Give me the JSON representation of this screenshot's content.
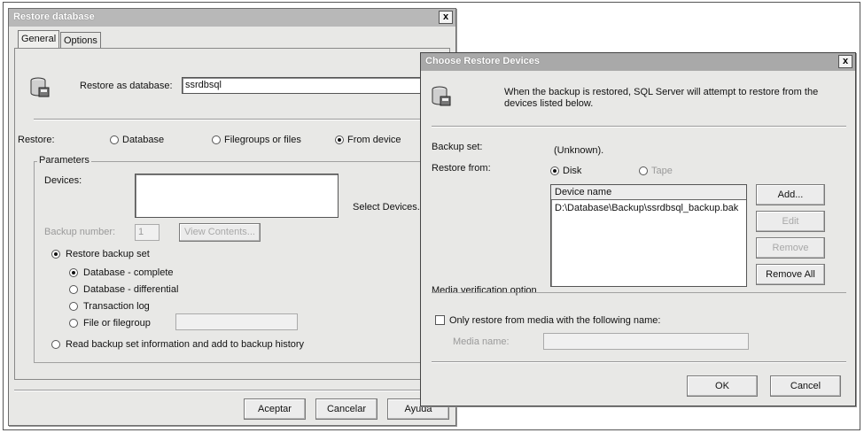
{
  "restore_dialog": {
    "title": "Restore database",
    "close_label": "x",
    "tabs": [
      "General",
      "Options"
    ],
    "restore_as_label": "Restore as database:",
    "restore_as_value": "ssrdbsql",
    "restore_label": "Restore:",
    "restore_options": [
      "Database",
      "Filegroups or files",
      "From device"
    ],
    "parameters_label": "Parameters",
    "devices_label": "Devices:",
    "select_devices_label": "Select Devices...",
    "backup_number_label": "Backup number:",
    "backup_number_value": "1",
    "view_contents_label": "View Contents...",
    "restore_backup_set_label": "Restore backup set",
    "backup_types": [
      "Database - complete",
      "Database - differential",
      "Transaction log",
      "File or filegroup"
    ],
    "read_backup_label": "Read backup set information and add to backup history",
    "buttons": [
      "Aceptar",
      "Cancelar",
      "Ayuda"
    ]
  },
  "devices_dialog": {
    "title": "Choose Restore Devices",
    "close_label": "x",
    "description": "When the backup is restored, SQL Server will attempt to restore from the devices listed below.",
    "backup_set_label": "Backup set:",
    "backup_set_value": "(Unknown).",
    "restore_from_label": "Restore from:",
    "restore_from_options": [
      "Disk",
      "Tape"
    ],
    "device_name_header": "Device name",
    "devices": [
      "D:\\Database\\Backup\\ssrdbsql_backup.bak"
    ],
    "side_buttons": [
      "Add...",
      "Edit",
      "Remove",
      "Remove All"
    ],
    "media_verification_label": "Media verification option",
    "only_restore_label": "Only restore from media with the following name:",
    "media_name_label": "Media name:",
    "ok_label": "OK",
    "cancel_label": "Cancel"
  },
  "icons": [
    "database-restore-icon",
    "close-icon",
    "radio-icon",
    "checkbox-icon"
  ]
}
